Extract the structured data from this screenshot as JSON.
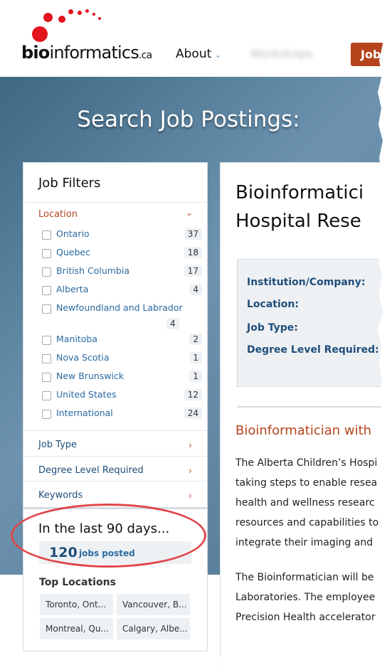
{
  "header": {
    "logo": {
      "bold": "bio",
      "rest": "informatics",
      "tld": ".ca"
    },
    "nav": {
      "about": "About",
      "blurred": "Workshops",
      "jobs": "Job"
    }
  },
  "hero": {
    "title": "Search Job Postings:"
  },
  "filters": {
    "title": "Job Filters",
    "location": {
      "heading": "Location",
      "items": [
        {
          "label": "Ontario",
          "count": "37"
        },
        {
          "label": "Quebec",
          "count": "18"
        },
        {
          "label": "British Columbia",
          "count": "17"
        },
        {
          "label": "Alberta",
          "count": "4"
        },
        {
          "label": "Newfoundland and Labrador",
          "count": "4"
        },
        {
          "label": "Manitoba",
          "count": "2"
        },
        {
          "label": "Nova Scotia",
          "count": "1"
        },
        {
          "label": "New Brunswick",
          "count": "1"
        },
        {
          "label": "United States",
          "count": "12"
        },
        {
          "label": "International",
          "count": "24"
        }
      ]
    },
    "sections": [
      "Job Type",
      "Degree Level Required",
      "Keywords"
    ],
    "stats": {
      "heading": "In the last 90 days...",
      "count": "120",
      "label": "jobs posted",
      "top_locations_title": "Top Locations",
      "top_locations": [
        "Toronto, Ont...",
        "Vancouver, B...",
        "Montreal, Qu...",
        "Calgary, Albe..."
      ]
    }
  },
  "job": {
    "title_line1": "Bioinformatici",
    "title_line2": "Hospital Rese",
    "info_labels": [
      "Institution/Company:",
      "Location:",
      "Job Type:",
      "Degree Level Required:"
    ],
    "subheading": "Bioinformatician with",
    "paragraph1": [
      "The Alberta Children’s Hospi",
      "taking steps to enable resea",
      "health and wellness researc",
      "resources and capabilities to",
      "integrate their imaging and"
    ],
    "paragraph2": [
      "The Bioinformatician will be",
      "Laboratories. The employee",
      "Precision Health accelerator"
    ]
  },
  "colors": {
    "accent": "#b5441c",
    "link": "#2b6aa0",
    "heading_blue": "#1f4e79",
    "annotation": "#e0474c"
  }
}
